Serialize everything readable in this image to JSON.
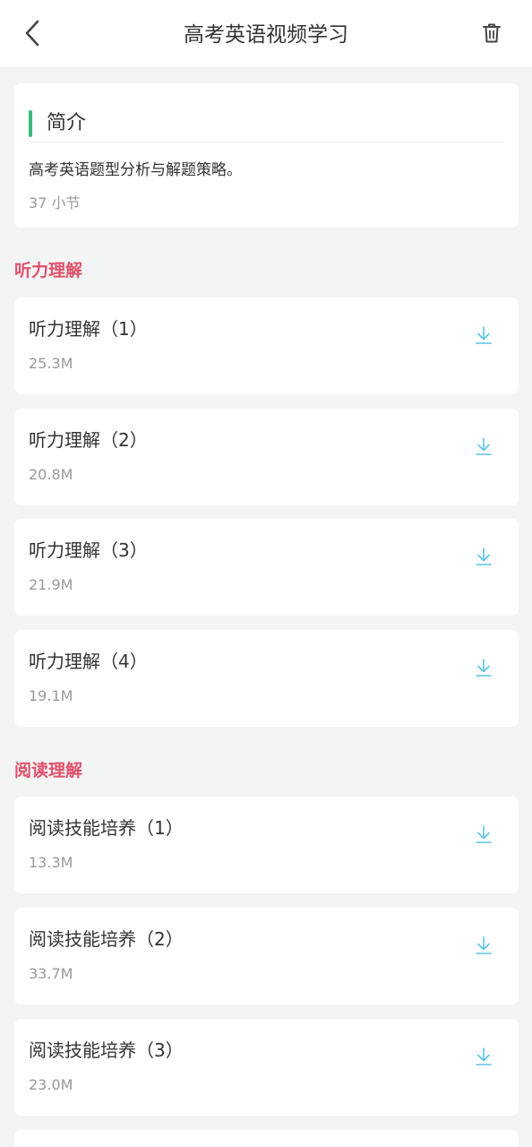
{
  "header": {
    "title": "高考英语视频学习",
    "back_icon": "chevron-left-icon",
    "delete_icon": "trash-icon"
  },
  "intro": {
    "title": "简介",
    "description": "高考英语题型分析与解题策略。",
    "count": "37 小节"
  },
  "colors": {
    "accent_green": "#3cb878",
    "section_red": "#e0506a",
    "download_blue": "#5bc4e6"
  },
  "sections": [
    {
      "title": "听力理解",
      "items": [
        {
          "name": "听力理解（1）",
          "size": "25.3M"
        },
        {
          "name": "听力理解（2）",
          "size": "20.8M"
        },
        {
          "name": "听力理解（3）",
          "size": "21.9M"
        },
        {
          "name": "听力理解（4）",
          "size": "19.1M"
        }
      ]
    },
    {
      "title": "阅读理解",
      "items": [
        {
          "name": "阅读技能培养（1）",
          "size": "13.3M"
        },
        {
          "name": "阅读技能培养（2）",
          "size": "33.7M"
        },
        {
          "name": "阅读技能培养（3）",
          "size": "23.0M"
        }
      ]
    }
  ]
}
